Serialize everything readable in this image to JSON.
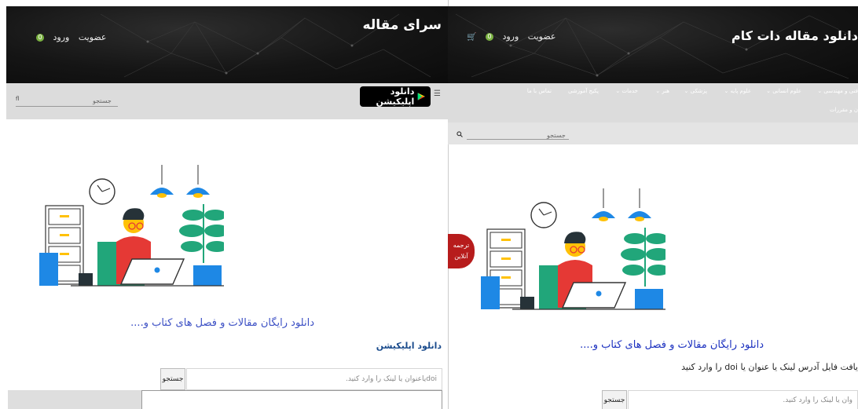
{
  "left": {
    "site_title": "سرای مقاله",
    "auth": {
      "login": "ورود",
      "register": "عضویت",
      "cart_count": "0"
    },
    "search_placeholder": "جستجو",
    "search_icon_glyph": "fl",
    "menu_glyph": "☰",
    "app_button": "دانلود اپلیکیشن",
    "subtitle": "دانلود رایگان مقالات و فصل های کتاب و....",
    "app_link": "دانلود اپلیکیشن",
    "input_placeholder": "doiیاعنوان یا لینک را وارد کنید.",
    "search_button": "جستجو"
  },
  "right": {
    "site_title": "دانلود مقاله دات کام",
    "auth": {
      "login": "ورود",
      "register": "عضویت",
      "cart_count": "0"
    },
    "nav": [
      {
        "label": "فنی و مهندسی"
      },
      {
        "label": "علوم انسانی"
      },
      {
        "label": "علوم پایه"
      },
      {
        "label": "پزشکی"
      },
      {
        "label": "هنر"
      },
      {
        "label": "خدمات"
      },
      {
        "label": "پکیج آموزشی"
      },
      {
        "label": "تماس با ما"
      }
    ],
    "nav_second": "ن و مقررات",
    "search_placeholder": "جستجو",
    "translate_badge": {
      "line1": "ترجمه",
      "line2": "آنلاین"
    },
    "subtitle": "دانلود رایگان مقالات و فصل های کتاب و....",
    "description": "یافت فایل آدرس لینک یا عنوان یا doi را وارد کنید",
    "input_placeholder": "وان یا لینک را وارد کنید.",
    "search_button": "جستجو"
  },
  "colors": {
    "hero_dark": "#151515",
    "bar_gray": "#dcdcdc",
    "subtitle_blue": "#3b4fc4",
    "badge_green": "#7cb342",
    "translate_red": "#b71c1c",
    "illustration_blue": "#1e88e5",
    "illustration_green": "#21a67a"
  }
}
